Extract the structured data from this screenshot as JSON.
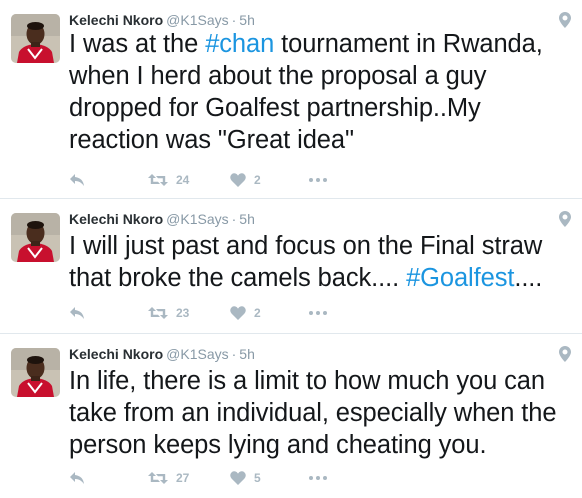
{
  "tweets": [
    {
      "name": "Kelechi Nkoro",
      "handle": "@K1Says",
      "separator": "·",
      "time": "5h",
      "text_parts": [
        {
          "t": "I was at the ",
          "tag": false
        },
        {
          "t": "#chan",
          "tag": true
        },
        {
          "t": " tournament in Rwanda, when I herd about the proposal a guy dropped for Goalfest partnership..My reaction was \"Great idea\"",
          "tag": false
        }
      ],
      "retweets": "24",
      "likes": "2"
    },
    {
      "name": "Kelechi Nkoro",
      "handle": "@K1Says",
      "separator": "·",
      "time": "5h",
      "text_parts": [
        {
          "t": "I will just past and focus on the Final straw that broke the camels back.... ",
          "tag": false
        },
        {
          "t": "#Goalfest",
          "tag": true
        },
        {
          "t": "....",
          "tag": false
        }
      ],
      "retweets": "23",
      "likes": "2"
    },
    {
      "name": "Kelechi Nkoro",
      "handle": "@K1Says",
      "separator": "·",
      "time": "5h",
      "text_parts": [
        {
          "t": "In life, there is a limit to how much you can take from an individual, especially when the person keeps lying and cheating you.",
          "tag": false
        }
      ],
      "retweets": "27",
      "likes": "5"
    }
  ],
  "colors": {
    "hashtag": "#1b95e0",
    "muted": "#8899a6",
    "action_icon": "#aab8c2",
    "text": "#14171a",
    "divider": "#e1e8ed"
  },
  "icons": {
    "reply": "reply-icon",
    "retweet": "retweet-icon",
    "like": "heart-icon",
    "more": "more-icon",
    "geo": "location-pin-icon"
  }
}
